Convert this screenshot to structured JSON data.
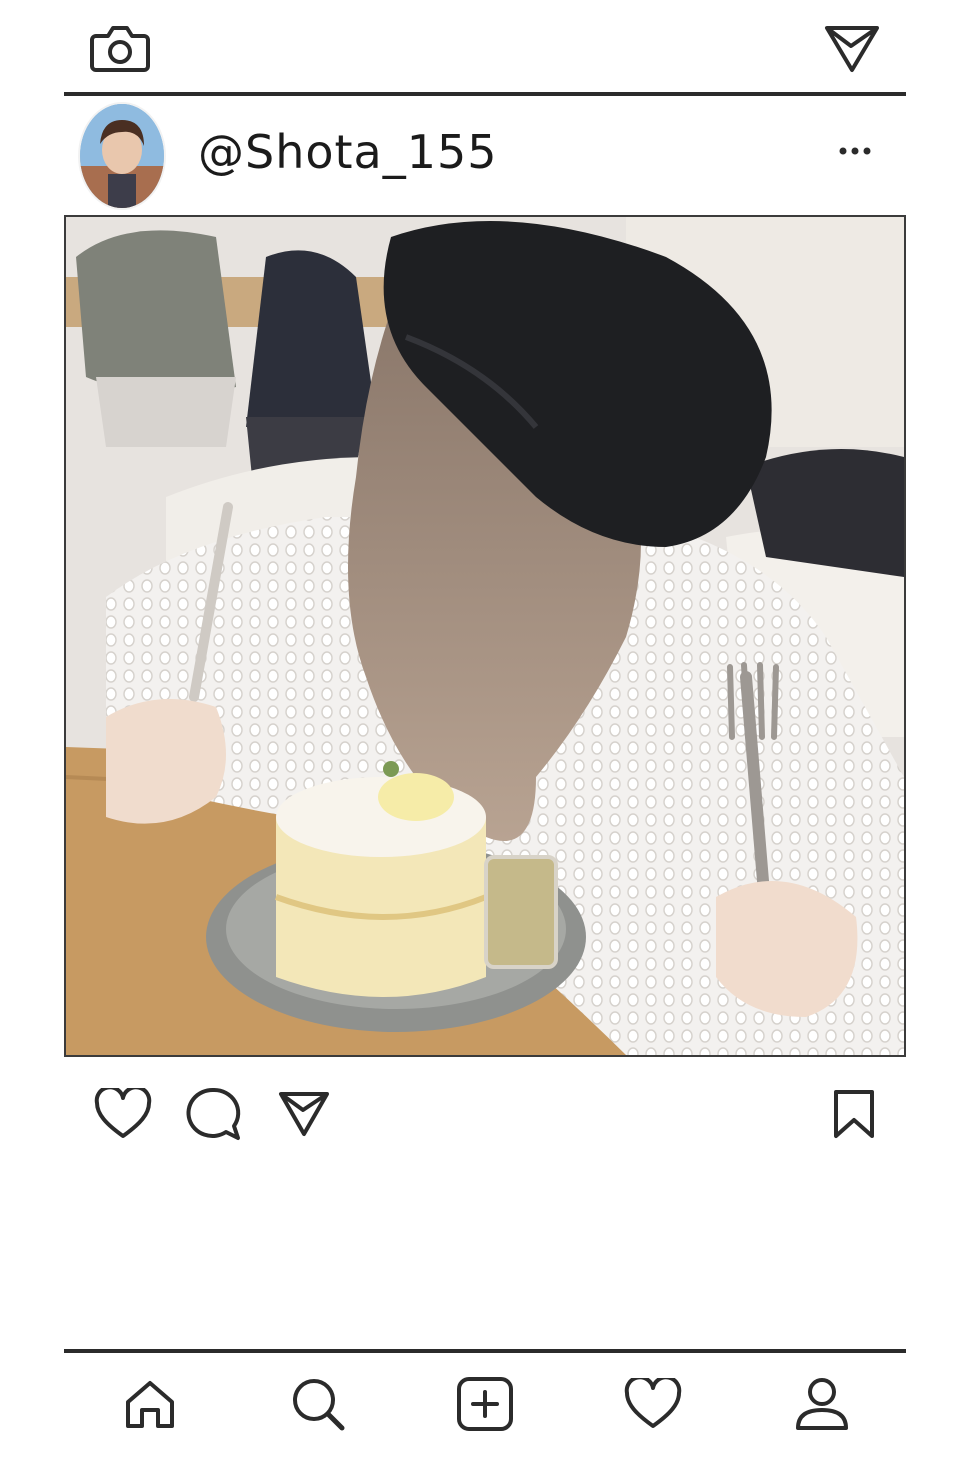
{
  "header": {
    "camera_icon": "camera-icon",
    "send_icon": "paper-plane-icon"
  },
  "post": {
    "username": "@Shota_155",
    "avatar_icon": "user-avatar",
    "more_icon": "more-dots-icon",
    "image_description_icon": "post-photo"
  },
  "actions": {
    "like_icon": "heart-icon",
    "comment_icon": "comment-bubble-icon",
    "share_icon": "paper-plane-icon",
    "save_icon": "bookmark-icon"
  },
  "nav": {
    "items": [
      "home-icon",
      "search-icon",
      "add-post-icon",
      "activity-heart-icon",
      "profile-icon"
    ]
  },
  "colors": {
    "line": "#2b2b2b",
    "background": "#ffffff"
  }
}
